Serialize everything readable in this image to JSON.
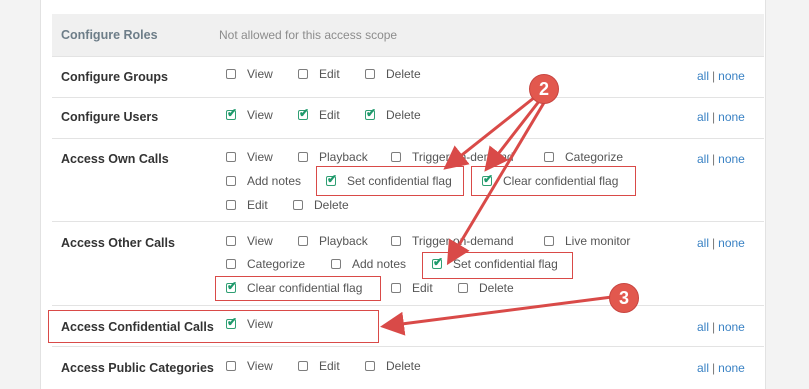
{
  "roles": {
    "name": "Configure Roles",
    "note": "Not allowed for this access scope"
  },
  "groups": {
    "name": "Configure Groups",
    "options": [
      {
        "label": "View",
        "checked": false
      },
      {
        "label": "Edit",
        "checked": false
      },
      {
        "label": "Delete",
        "checked": false
      }
    ]
  },
  "users": {
    "name": "Configure Users",
    "options": [
      {
        "label": "View",
        "checked": true
      },
      {
        "label": "Edit",
        "checked": true
      },
      {
        "label": "Delete",
        "checked": true
      }
    ]
  },
  "own_calls": {
    "name": "Access Own Calls",
    "options": [
      {
        "label": "View",
        "checked": false
      },
      {
        "label": "Playback",
        "checked": false
      },
      {
        "label": "Trigger on-demand",
        "checked": false
      },
      {
        "label": "Categorize",
        "checked": false
      },
      {
        "label": "Add notes",
        "checked": false
      },
      {
        "label": "Set confidential flag",
        "checked": true
      },
      {
        "label": "Clear confidential flag",
        "checked": true
      },
      {
        "label": "Edit",
        "checked": false
      },
      {
        "label": "Delete",
        "checked": false
      }
    ]
  },
  "other_calls": {
    "name": "Access Other Calls",
    "options": [
      {
        "label": "View",
        "checked": false
      },
      {
        "label": "Playback",
        "checked": false
      },
      {
        "label": "Trigger on-demand",
        "checked": false
      },
      {
        "label": "Live monitor",
        "checked": false
      },
      {
        "label": "Categorize",
        "checked": false
      },
      {
        "label": "Add notes",
        "checked": false
      },
      {
        "label": "Set confidential flag",
        "checked": true
      },
      {
        "label": "Clear confidential flag",
        "checked": true
      },
      {
        "label": "Edit",
        "checked": false
      },
      {
        "label": "Delete",
        "checked": false
      }
    ]
  },
  "confidential_calls": {
    "name": "Access Confidential Calls",
    "options": [
      {
        "label": "View",
        "checked": true
      }
    ]
  },
  "public_categories": {
    "name": "Access Public Categories",
    "options": [
      {
        "label": "View",
        "checked": false
      },
      {
        "label": "Edit",
        "checked": false
      },
      {
        "label": "Delete",
        "checked": false
      }
    ]
  },
  "links": {
    "all": "all",
    "sep": "|",
    "none": "none"
  },
  "callouts": {
    "two": "2",
    "three": "3"
  },
  "colors": {
    "accent": "#1f9a6c",
    "link": "#3a82c4",
    "annotation": "#d94a48"
  }
}
